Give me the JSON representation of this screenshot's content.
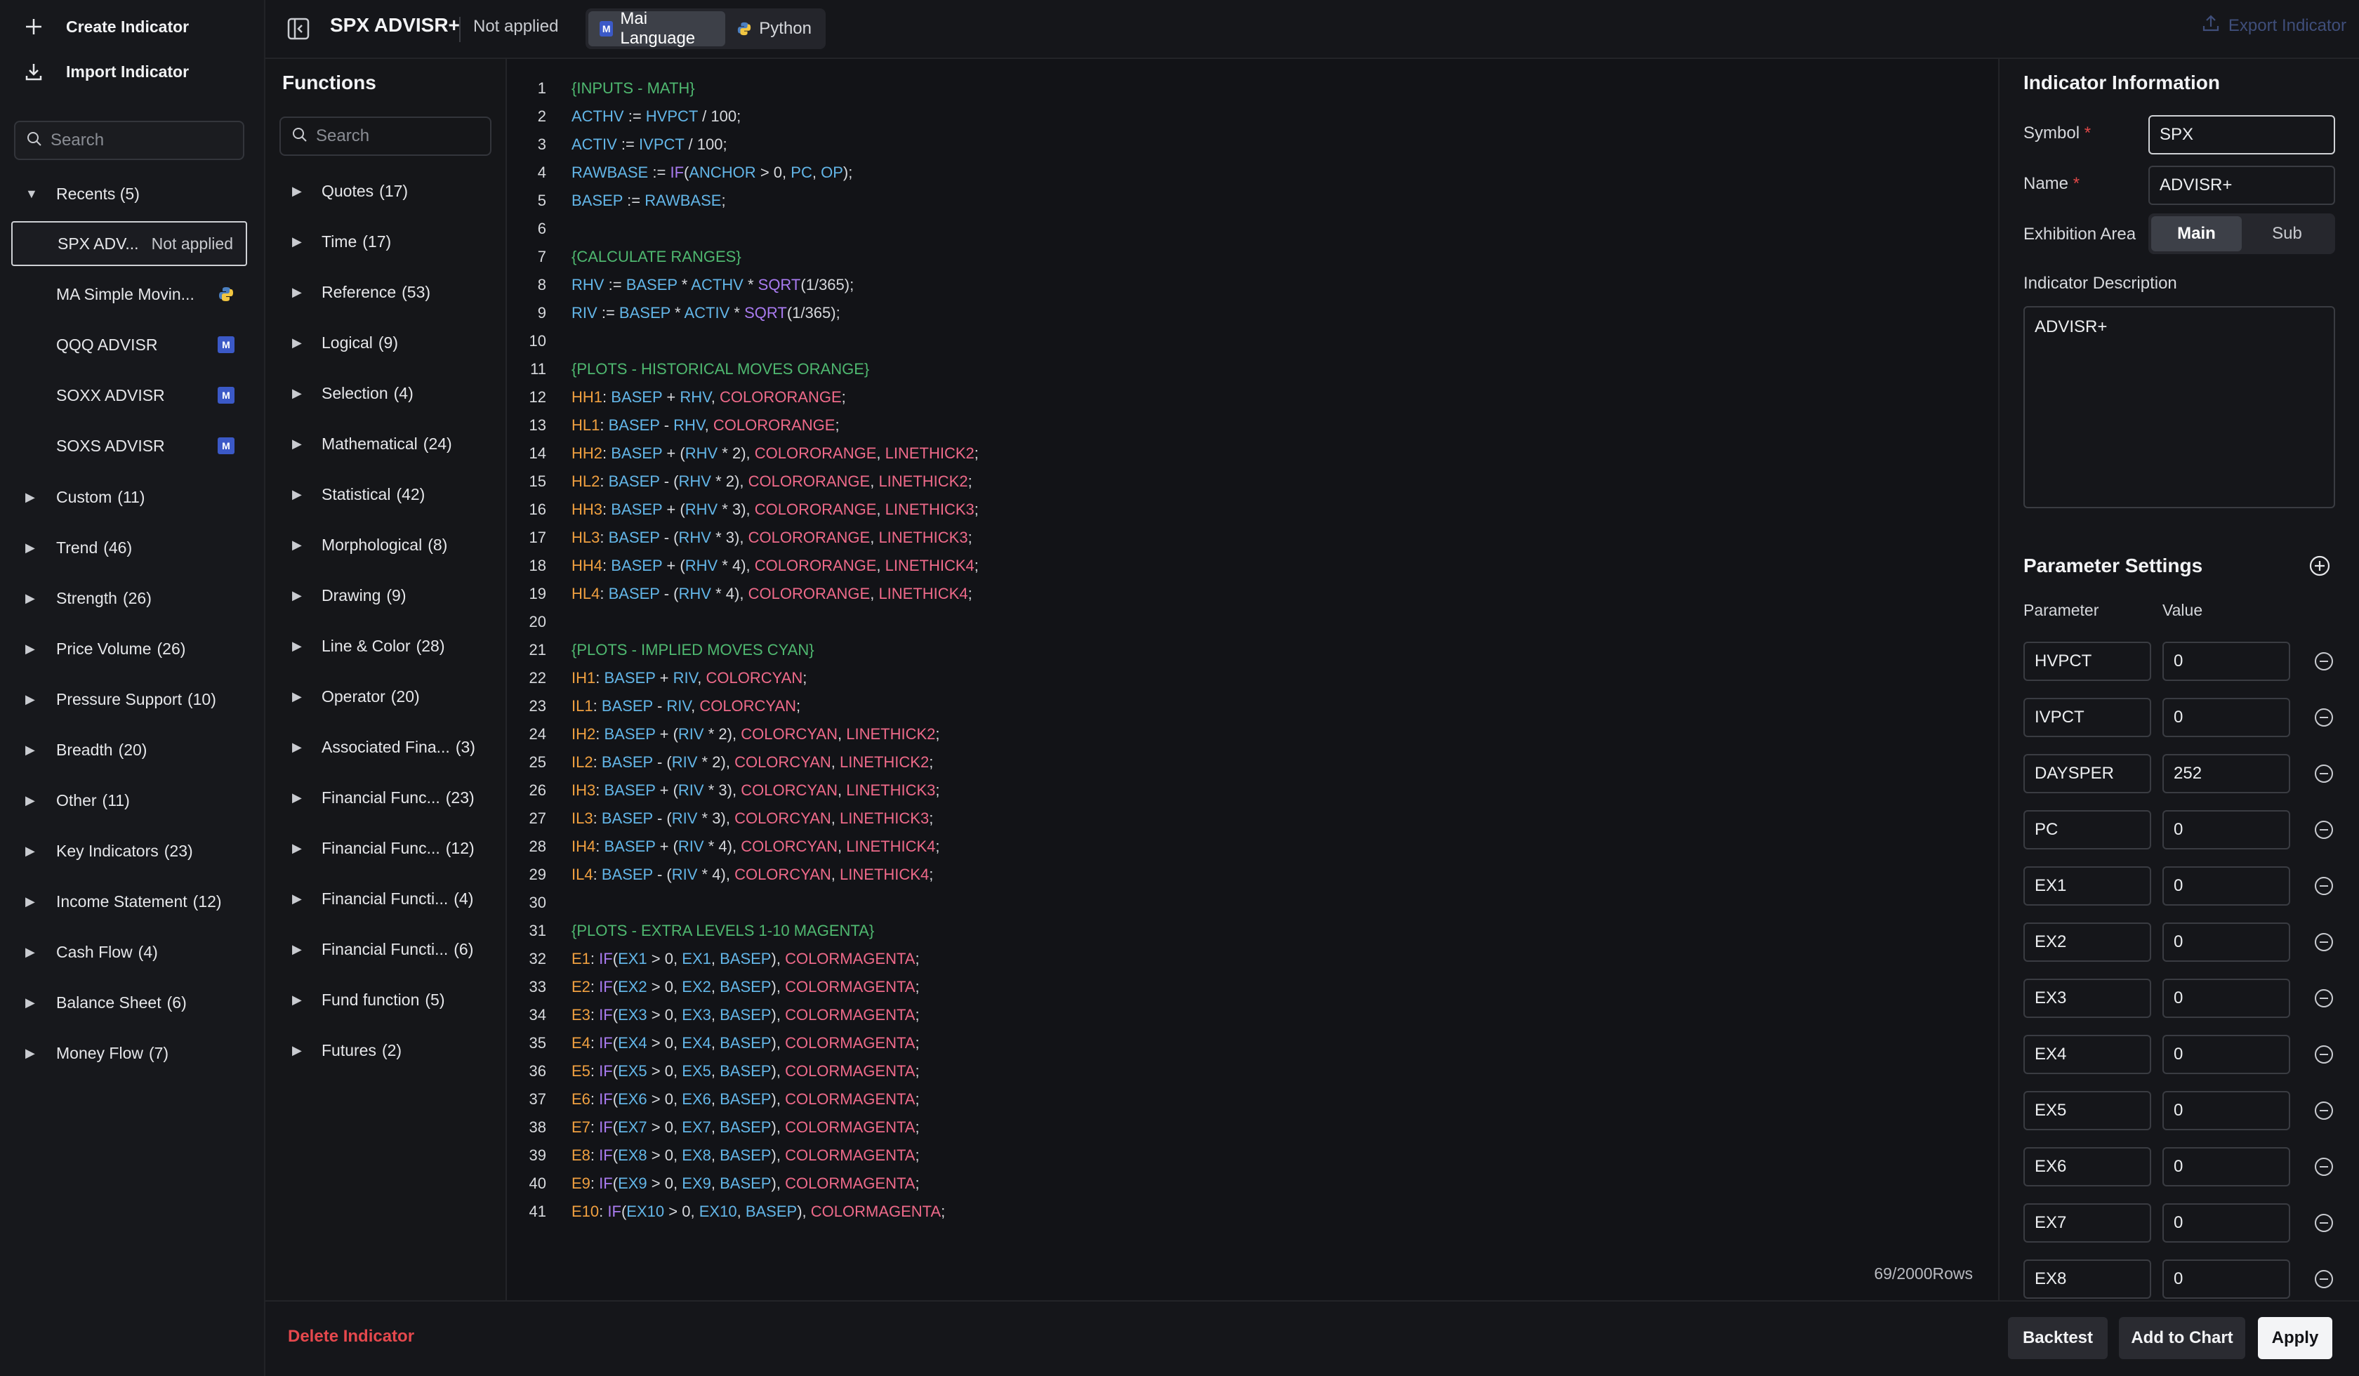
{
  "sidebar": {
    "create_label": "Create Indicator",
    "import_label": "Import Indicator",
    "search_placeholder": "Search",
    "recents_label": "Recents (5)",
    "recents": [
      {
        "label": "SPX ADV...",
        "status": "Not applied",
        "badge": "none"
      },
      {
        "label": "MA Simple Movin...",
        "status": "",
        "badge": "python"
      },
      {
        "label": "QQQ ADVISR",
        "status": "",
        "badge": "mai"
      },
      {
        "label": "SOXX ADVISR",
        "status": "",
        "badge": "mai"
      },
      {
        "label": "SOXS ADVISR",
        "status": "",
        "badge": "mai"
      }
    ],
    "groups": [
      {
        "name": "Custom",
        "count": "(11)"
      },
      {
        "name": "Trend",
        "count": "(46)"
      },
      {
        "name": "Strength",
        "count": "(26)"
      },
      {
        "name": "Price Volume",
        "count": "(26)"
      },
      {
        "name": "Pressure Support",
        "count": "(10)"
      },
      {
        "name": "Breadth",
        "count": "(20)"
      },
      {
        "name": "Other",
        "count": "(11)"
      },
      {
        "name": "Key Indicators",
        "count": "(23)"
      },
      {
        "name": "Income Statement",
        "count": "(12)"
      },
      {
        "name": "Cash Flow",
        "count": "(4)"
      },
      {
        "name": "Balance Sheet",
        "count": "(6)"
      },
      {
        "name": "Money Flow",
        "count": "(7)"
      }
    ]
  },
  "topbar": {
    "title": "SPX ADVISR+",
    "status": "Not applied",
    "lang_tabs": [
      {
        "label": "Mai Language",
        "active": true
      },
      {
        "label": "Python",
        "active": false
      }
    ],
    "export_label": "Export Indicator"
  },
  "functions": {
    "title": "Functions",
    "search_placeholder": "Search",
    "items": [
      {
        "name": "Quotes",
        "count": "(17)"
      },
      {
        "name": "Time",
        "count": "(17)"
      },
      {
        "name": "Reference",
        "count": "(53)"
      },
      {
        "name": "Logical",
        "count": "(9)"
      },
      {
        "name": "Selection",
        "count": "(4)"
      },
      {
        "name": "Mathematical",
        "count": "(24)"
      },
      {
        "name": "Statistical",
        "count": "(42)"
      },
      {
        "name": "Morphological",
        "count": "(8)"
      },
      {
        "name": "Drawing",
        "count": "(9)"
      },
      {
        "name": "Line & Color",
        "count": "(28)"
      },
      {
        "name": "Operator",
        "count": "(20)"
      },
      {
        "name": "Associated Fina...",
        "count": "(3)"
      },
      {
        "name": "Financial Func...",
        "count": "(23)"
      },
      {
        "name": "Financial Func...",
        "count": "(12)"
      },
      {
        "name": "Financial Functi...",
        "count": "(4)"
      },
      {
        "name": "Financial Functi...",
        "count": "(6)"
      },
      {
        "name": "Fund function",
        "count": "(5)"
      },
      {
        "name": "Futures",
        "count": "(2)"
      }
    ]
  },
  "editor": {
    "lines": [
      "{INPUTS - MATH}",
      "ACTHV := HVPCT / 100;",
      "ACTIV := IVPCT / 100;",
      "RAWBASE := IF(ANCHOR > 0, PC, OP);",
      "BASEP := RAWBASE;",
      "",
      "{CALCULATE RANGES}",
      "RHV := BASEP * ACTHV * SQRT(1/365);",
      "RIV := BASEP * ACTIV * SQRT(1/365);",
      "",
      "{PLOTS - HISTORICAL MOVES ORANGE}",
      "HH1: BASEP + RHV, COLORORANGE;",
      "HL1: BASEP - RHV, COLORORANGE;",
      "HH2: BASEP + (RHV * 2), COLORORANGE, LINETHICK2;",
      "HL2: BASEP - (RHV * 2), COLORORANGE, LINETHICK2;",
      "HH3: BASEP + (RHV * 3), COLORORANGE, LINETHICK3;",
      "HL3: BASEP - (RHV * 3), COLORORANGE, LINETHICK3;",
      "HH4: BASEP + (RHV * 4), COLORORANGE, LINETHICK4;",
      "HL4: BASEP - (RHV * 4), COLORORANGE, LINETHICK4;",
      "",
      "{PLOTS - IMPLIED MOVES CYAN}",
      "IH1: BASEP + RIV, COLORCYAN;",
      "IL1: BASEP - RIV, COLORCYAN;",
      "IH2: BASEP + (RIV * 2), COLORCYAN, LINETHICK2;",
      "IL2: BASEP - (RIV * 2), COLORCYAN, LINETHICK2;",
      "IH3: BASEP + (RIV * 3), COLORCYAN, LINETHICK3;",
      "IL3: BASEP - (RIV * 3), COLORCYAN, LINETHICK3;",
      "IH4: BASEP + (RIV * 4), COLORCYAN, LINETHICK4;",
      "IL4: BASEP - (RIV * 4), COLORCYAN, LINETHICK4;",
      "",
      "{PLOTS - EXTRA LEVELS 1-10 MAGENTA}",
      "E1: IF(EX1 > 0, EX1, BASEP), COLORMAGENTA;",
      "E2: IF(EX2 > 0, EX2, BASEP), COLORMAGENTA;",
      "E3: IF(EX3 > 0, EX3, BASEP), COLORMAGENTA;",
      "E4: IF(EX4 > 0, EX4, BASEP), COLORMAGENTA;",
      "E5: IF(EX5 > 0, EX5, BASEP), COLORMAGENTA;",
      "E6: IF(EX6 > 0, EX6, BASEP), COLORMAGENTA;",
      "E7: IF(EX7 > 0, EX7, BASEP), COLORMAGENTA;",
      "E8: IF(EX8 > 0, EX8, BASEP), COLORMAGENTA;",
      "E9: IF(EX9 > 0, EX9, BASEP), COLORMAGENTA;",
      "E10: IF(EX10 > 0, EX10, BASEP), COLORMAGENTA;"
    ],
    "rows_count": "69/2000Rows"
  },
  "info": {
    "title": "Indicator Information",
    "symbol_label": "Symbol",
    "symbol_value": "SPX",
    "name_label": "Name",
    "name_value": "ADVISR+",
    "exhibition_label": "Exhibition Area",
    "exhibition_options": [
      "Main",
      "Sub"
    ],
    "exhibition_selected": "Main",
    "description_label": "Indicator Description",
    "description_value": "ADVISR+",
    "required_mark": "*"
  },
  "params": {
    "title": "Parameter Settings",
    "col_param": "Parameter",
    "col_value": "Value",
    "rows": [
      {
        "name": "HVPCT",
        "value": "0"
      },
      {
        "name": "IVPCT",
        "value": "0"
      },
      {
        "name": "DAYSPER",
        "value": "252"
      },
      {
        "name": "PC",
        "value": "0"
      },
      {
        "name": "EX1",
        "value": "0"
      },
      {
        "name": "EX2",
        "value": "0"
      },
      {
        "name": "EX3",
        "value": "0"
      },
      {
        "name": "EX4",
        "value": "0"
      },
      {
        "name": "EX5",
        "value": "0"
      },
      {
        "name": "EX6",
        "value": "0"
      },
      {
        "name": "EX7",
        "value": "0"
      },
      {
        "name": "EX8",
        "value": "0"
      }
    ]
  },
  "footer": {
    "delete_label": "Delete Indicator",
    "backtest_label": "Backtest",
    "add_chart_label": "Add to Chart",
    "apply_label": "Apply"
  },
  "colors": {
    "comment": "#4fb870",
    "var": "#63b6e8",
    "func": "#a97bf0",
    "number": "#d6d8dc",
    "color_const": "#ef6a8a",
    "plot_name": "#f0a040",
    "accent_blue": "#3b59c7",
    "danger": "#e5484d"
  }
}
